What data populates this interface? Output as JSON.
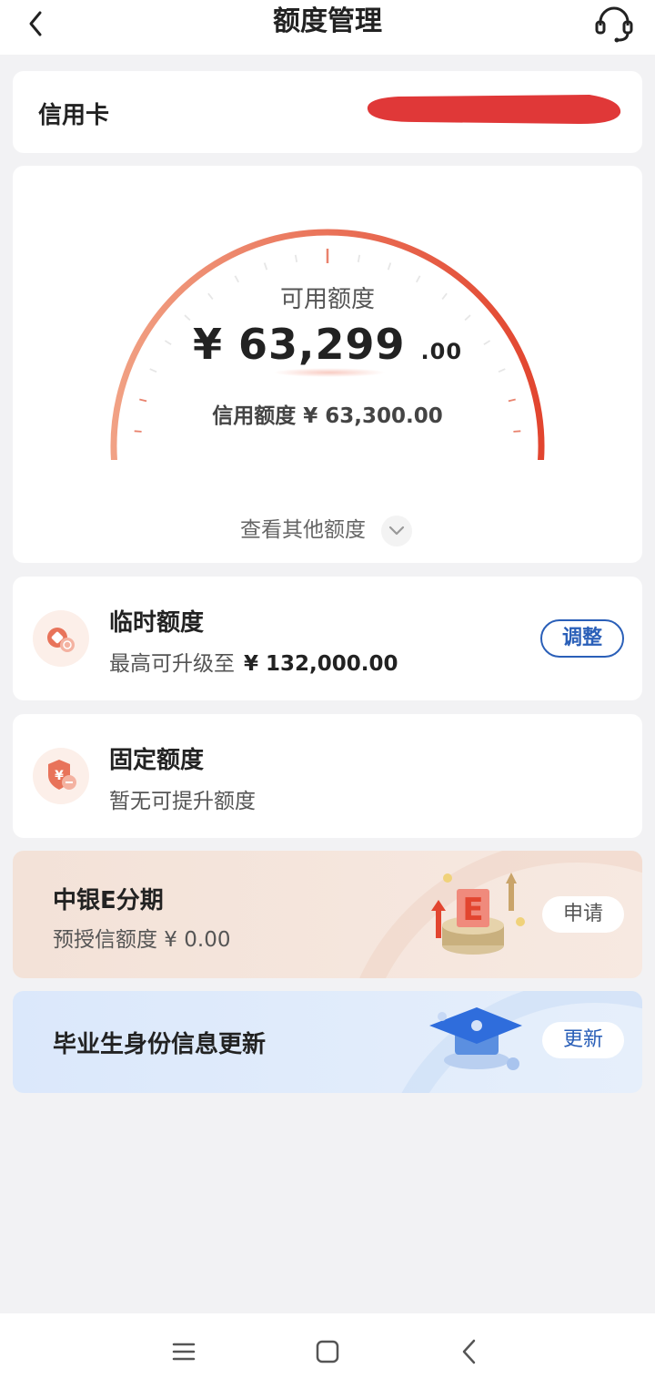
{
  "header": {
    "title": "额度管理",
    "back_icon": "back-arrow-icon",
    "service_icon": "headset-icon"
  },
  "card_info": {
    "label": "信用卡"
  },
  "gauge": {
    "label": "可用额度",
    "currency": "¥",
    "available_integer": "63,299",
    "available_cents": ".00",
    "credit_limit_text": "信用额度 ¥ 63,300.00",
    "fill_fraction": 1.0,
    "colors": {
      "start": "#f1a184",
      "end": "#e2452f"
    }
  },
  "other_quota": {
    "label": "查看其他额度"
  },
  "temp_quota": {
    "title": "临时额度",
    "subtitle": "最高可升级至",
    "amount": "¥ 132,000.00",
    "button": "调整"
  },
  "fixed_quota": {
    "title": "固定额度",
    "subtitle": "暂无可提升额度"
  },
  "promo_installment": {
    "title": "中银E分期",
    "subtitle": "预授信额度 ¥ 0.00",
    "button": "申请",
    "badge_letter": "E"
  },
  "promo_graduate": {
    "title": "毕业生身份信息更新",
    "button": "更新"
  },
  "navbar": {
    "items": [
      "menu-icon",
      "home-square-icon",
      "back-triangle-icon"
    ]
  },
  "colors": {
    "accent_red": "#e2452f",
    "accent_blue": "#2a5fb8",
    "promo_peach": "#f5e4db",
    "promo_blue": "#e0ebfa"
  }
}
